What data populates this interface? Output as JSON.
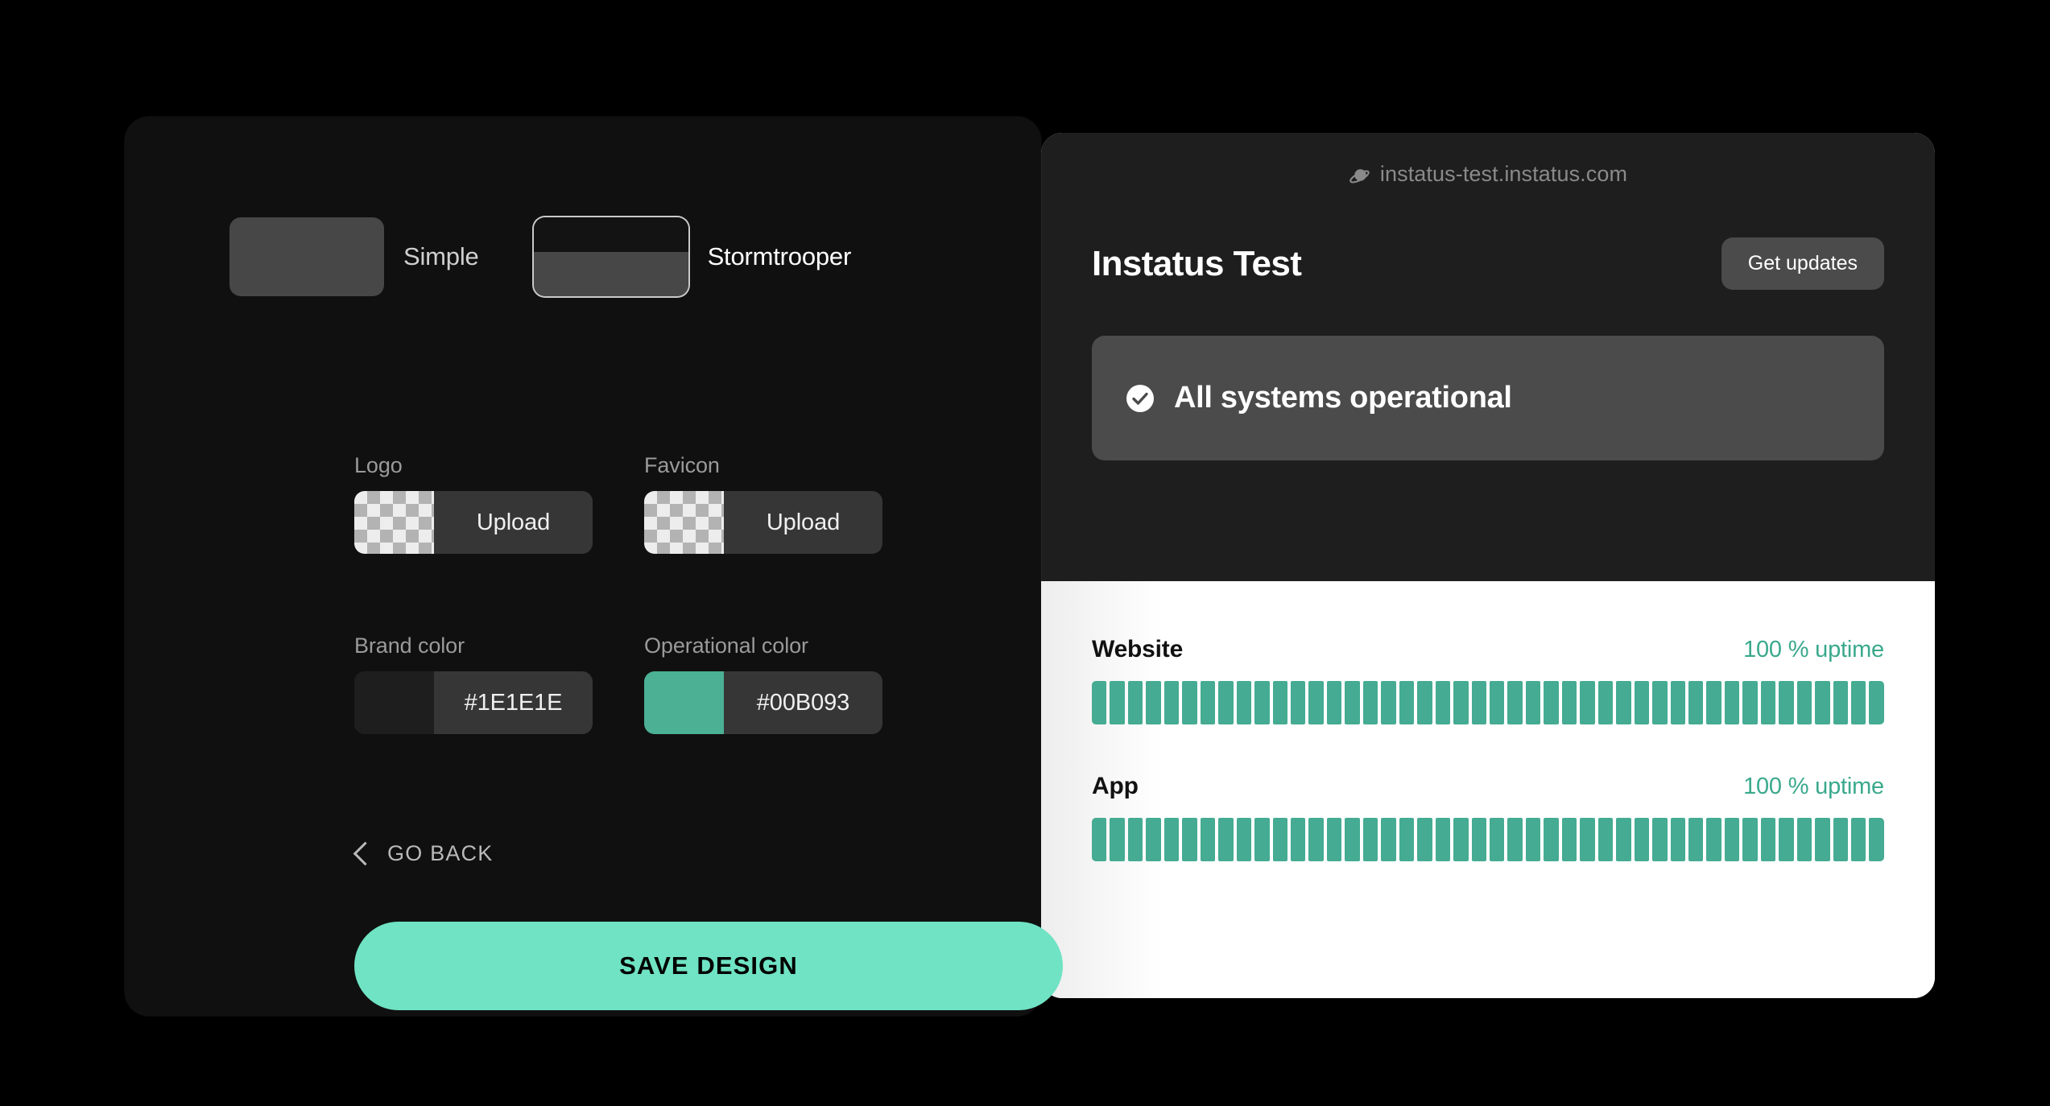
{
  "editor": {
    "themes": [
      {
        "label": "Simple",
        "selected": false,
        "style": "flat"
      },
      {
        "label": "Stormtrooper",
        "selected": true,
        "style": "split"
      }
    ],
    "fields": {
      "logo": {
        "label": "Logo",
        "action": "Upload",
        "swatch": "checkerboard"
      },
      "favicon": {
        "label": "Favicon",
        "action": "Upload",
        "swatch": "checkerboard"
      },
      "brand_color": {
        "label": "Brand color",
        "value": "#1E1E1E",
        "swatch": "#1E1E1E"
      },
      "operational_color": {
        "label": "Operational color",
        "value": "#00B093",
        "swatch": "#4BB094"
      }
    },
    "go_back_label": "GO BACK",
    "save_label": "SAVE DESIGN",
    "save_color": "#6FE3C3"
  },
  "preview": {
    "url": "instatus-test.instatus.com",
    "url_icon": "planet-icon",
    "title": "Instatus Test",
    "get_updates_label": "Get updates",
    "status": {
      "icon": "check-circle-icon",
      "text": "All systems operational"
    },
    "uptime_tick_count": 44,
    "uptime_color": "#45AB92",
    "services": [
      {
        "name": "Website",
        "uptime": "100 % uptime"
      },
      {
        "name": "App",
        "uptime": "100 % uptime"
      }
    ]
  }
}
